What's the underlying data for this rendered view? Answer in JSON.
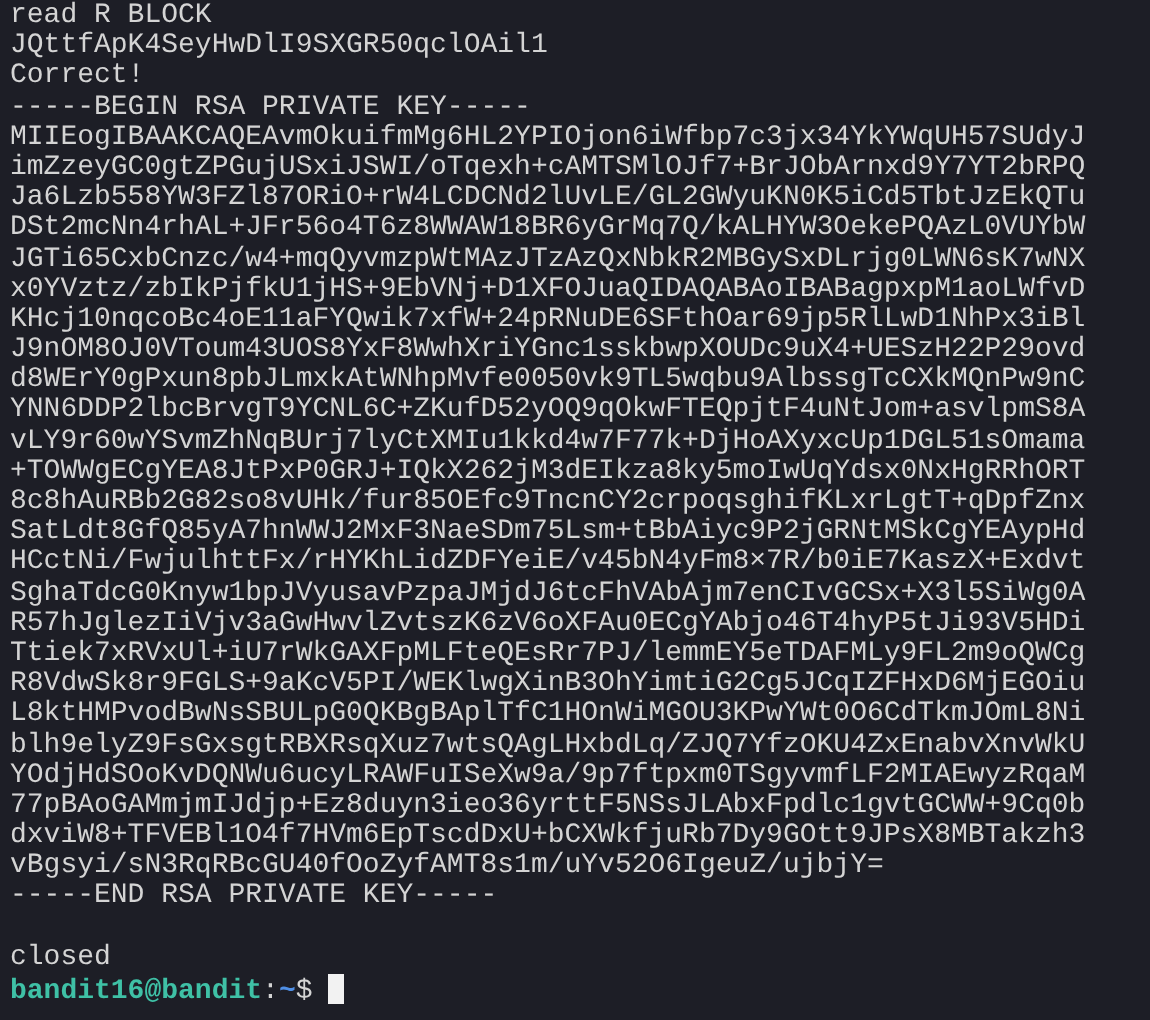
{
  "lines": [
    "read R BLOCK",
    "JQttfApK4SeyHwDlI9SXGR50qclOAil1",
    "Correct!",
    "-----BEGIN RSA PRIVATE KEY-----",
    "MIIEogIBAAKCAQEAvmOkuifmMg6HL2YPIOjon6iWfbp7c3jx34YkYWqUH57SUdyJ",
    "imZzeyGC0gtZPGujUSxiJSWI/oTqexh+cAMTSMlOJf7+BrJObArnxd9Y7YT2bRPQ",
    "Ja6Lzb558YW3FZl87ORiO+rW4LCDCNd2lUvLE/GL2GWyuKN0K5iCd5TbtJzEkQTu",
    "DSt2mcNn4rhAL+JFr56o4T6z8WWAW18BR6yGrMq7Q/kALHYW3OekePQAzL0VUYbW",
    "JGTi65CxbCnzc/w4+mqQyvmzpWtMAzJTzAzQxNbkR2MBGySxDLrjg0LWN6sK7wNX",
    "x0YVztz/zbIkPjfkU1jHS+9EbVNj+D1XFOJuaQIDAQABAoIBABagpxpM1aoLWfvD",
    "KHcj10nqcoBc4oE11aFYQwik7xfW+24pRNuDE6SFthOar69jp5RlLwD1NhPx3iBl",
    "J9nOM8OJ0VToum43UOS8YxF8WwhXriYGnc1sskbwpXOUDc9uX4+UESzH22P29ovd",
    "d8WErY0gPxun8pbJLmxkAtWNhpMvfe0050vk9TL5wqbu9AlbssgTcCXkMQnPw9nC",
    "YNN6DDP2lbcBrvgT9YCNL6C+ZKufD52yOQ9qOkwFTEQpjtF4uNtJom+asvlpmS8A",
    "vLY9r60wYSvmZhNqBUrj7lyCtXMIu1kkd4w7F77k+DjHoAXyxcUp1DGL51sOmama",
    "+TOWWgECgYEA8JtPxP0GRJ+IQkX262jM3dEIkza8ky5moIwUqYdsx0NxHgRRhORT",
    "8c8hAuRBb2G82so8vUHk/fur85OEfc9TncnCY2crpoqsghifKLxrLgtT+qDpfZnx",
    "SatLdt8GfQ85yA7hnWWJ2MxF3NaeSDm75Lsm+tBbAiyc9P2jGRNtMSkCgYEAypHd",
    "HCctNi/FwjulhttFx/rHYKhLidZDFYeiE/v45bN4yFm8×7R/b0iE7KaszX+Exdvt",
    "SghaTdcG0Knyw1bpJVyusavPzpaJMjdJ6tcFhVAbAjm7enCIvGCSx+X3l5SiWg0A",
    "R57hJglezIiVjv3aGwHwvlZvtszK6zV6oXFAu0ECgYAbjo46T4hyP5tJi93V5HDi",
    "Ttiek7xRVxUl+iU7rWkGAXFpMLFteQEsRr7PJ/lemmEY5eTDAFMLy9FL2m9oQWCg",
    "R8VdwSk8r9FGLS+9aKcV5PI/WEKlwgXinB3OhYimtiG2Cg5JCqIZFHxD6MjEGOiu",
    "L8ktHMPvodBwNsSBULpG0QKBgBAplTfC1HOnWiMGOU3KPwYWt0O6CdTkmJOmL8Ni",
    "blh9elyZ9FsGxsgtRBXRsqXuz7wtsQAgLHxbdLq/ZJQ7YfzOKU4ZxEnabvXnvWkU",
    "YOdjHdSOoKvDQNWu6ucyLRAWFuISeXw9a/9p7ftpxm0TSgyvmfLF2MIAEwyzRqaM",
    "77pBAoGAMmjmIJdjp+Ez8duyn3ieo36yrttF5NSsJLAbxFpdlc1gvtGCWW+9Cq0b",
    "dxviW8+TFVEBl1O4f7HVm6EpTscdDxU+bCXWkfjuRb7Dy9GOtt9JPsX8MBTakzh3",
    "vBgsyi/sN3RqRBcGU40fOoZyfAMT8s1m/uYv52O6IgeuZ/ujbjY=",
    "-----END RSA PRIVATE KEY-----"
  ],
  "closing_message": "closed",
  "prompt": {
    "user_host": "bandit16@bandit",
    "separator": ":",
    "path": "~",
    "symbol": "$"
  }
}
